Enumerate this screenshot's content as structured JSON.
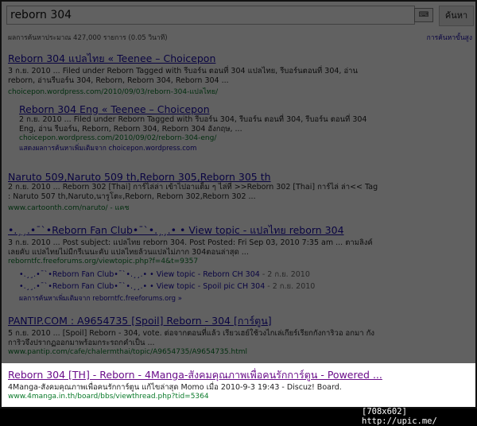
{
  "search": {
    "query": "reborn 304",
    "button": "ค้นหา",
    "keyboard_label": "⌨"
  },
  "stats": "ผลการค้นหาประมาณ 427,000 รายการ (0.05 วินาที)",
  "tools": "การค้นหาขั้นสูง",
  "results": [
    {
      "title": "Reborn 304 แปลไทย « Teenee – Choicepon",
      "snippet": "3 ก.ย. 2010 ... Filed under Reborn Tagged with รีบอร์น ตอนที่ 304 แปลไทย, รีบอร์นตอนที่ 304, อ่าน reborn, อ่านรีบอร์น 304, Reborn, Reborn 304, Reborn 304 ...",
      "url": "choicepon.wordpress.com/2010/09/03/reborn-304-แปลไทย/"
    },
    {
      "title": "Reborn 304 Eng « Teenee – Choicepon",
      "snippet": "2 ก.ย. 2010 ... Filed under Reborn Tagged with รีบอร์น 304, รีบอร์น ตอนที่ 304, รีบอร์น ตอนที่ 304 Eng, อ่าน รีบอร์น, Reborn, Reborn 304, Reborn 304 อังกฤษ, ...",
      "url": "choicepon.wordpress.com/2010/09/02/reborn-304-eng/",
      "more": "แสดงผลการค้นหาเพิ่มเติมจาก choicepon.wordpress.com"
    },
    {
      "title": "Naruto 509,Naruto 509 th,Reborn 305,Reborn 305 th",
      "snippet": "2 ก.ย. 2010 ... Reborn 302 [Thai] การ์ไล่ล่า เข้าไปอาแต็ม ๆ ไล่ที่ >>Reborn 302 [Thai] การ์ไล่ ล่า<< Tag : Naruto 507 th,Naruto,นารูโตะ,Reborn, Reborn 302,Reborn 302 ...",
      "url": "www.cartoonth.com/naruto/ - แคช"
    },
    {
      "title": "•.¸¸.•¯`•Reborn Fan Club•¯`•.¸¸.• • View topic - แปลไทย reborn 304",
      "snippet": "3 ก.ย. 2010 ... Post subject: แปลไทย reborn 304. Post Posted: Fri Sep 03, 2010 7:35 am ... ตามลิงค์เลยคับ แปลไทยไม่มีกรีเนนะคับ แปลไทยล้วนแปลไม่ภาก 304ตอนล่าสุด ...",
      "url": "reborntfc.freeforums.org/viewtopic.php?f=4&t=9357",
      "subs": [
        {
          "label": "•.¸¸.•¯`•Reborn Fan Club•¯`•.¸¸.• • View topic - Reborn CH 304",
          "date": " - 2 ก.ย. 2010"
        },
        {
          "label": "•.¸¸.•¯`•Reborn Fan Club•¯`•.¸¸.• • View topic - Spoil pic CH 304",
          "date": " - 2 ก.ย. 2010"
        }
      ],
      "more": "ผลการค้นหาเพิ่มเติมจาก reborntfc.freeforums.org »"
    },
    {
      "title": "PANTIP.COM : A9654735 [Spoil] Reborn - 304 [การ์ตูน]",
      "snippet": "5 ก.ย. 2010 ... [Spoil] Reborn - 304, vote. ต่อจากตอนที่แล้ว เรียวเฮย์ใช้วงไกเล่เกียร์เรียกกังการิวอ อกมา กังการิวจึงปรากฏออกมาพร้อมกระรถกคำเป็น ...",
      "url": "www.pantip.com/cafe/chalermthai/topic/A9654735/A9654735.html"
    },
    {
      "title": "Reborn 304 [TH] - Reborn - 4Manga-สังคมคุณภาพเพื่อคนรักการ์ตูน - Powered ...",
      "snippet": "4Manga-สังคมคุณภาพเพื่อคนรักการ์ตูน แก้ไขล่าสุด Momo เมื่อ 2010-9-3 19:43 - Discuz! Board.",
      "url": "www.4manga.in.th/board/bbs/viewthread.php?tid=5364"
    }
  ],
  "watermark": "[708x602] http://upic.me/"
}
